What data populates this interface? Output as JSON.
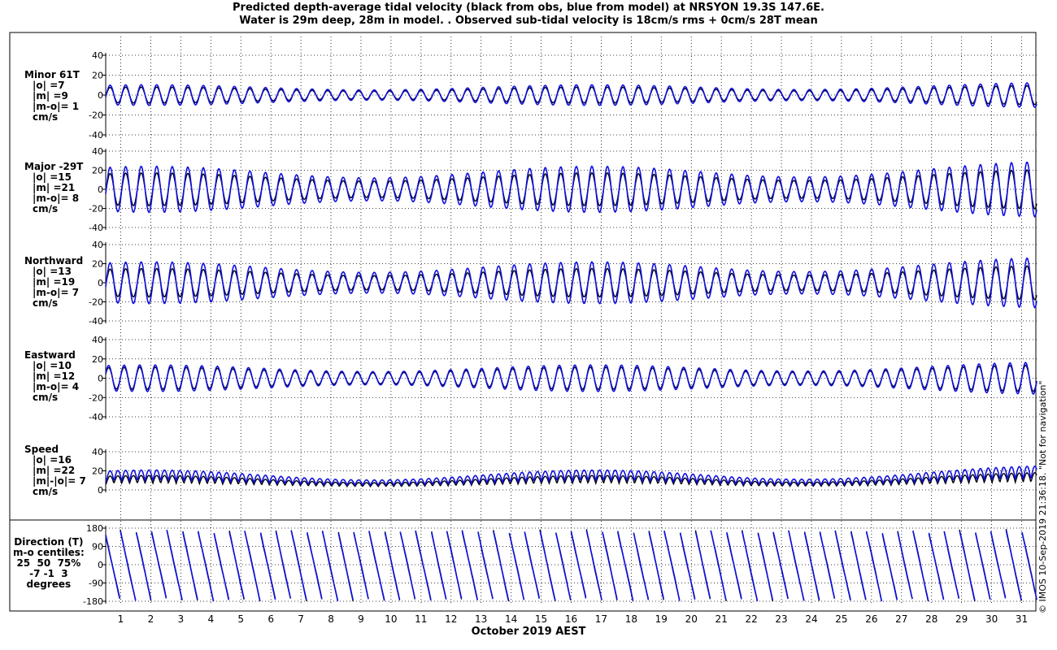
{
  "title": {
    "line1": "Predicted depth-average tidal velocity (black from obs, blue from model) at NRSYON 19.3S 147.6E.",
    "line2": "Water is 29m deep, 28m in model. . Observed sub-tidal velocity is 18cm/s rms + 0cm/s 28T mean"
  },
  "xlabel": "October 2019 AEST",
  "credit": "© IMOS 10-Sep-2019 21:36:18.  \"Not for navigation\"",
  "colors": {
    "obs": "#000000",
    "model": "#1010e0",
    "grid": "#000000"
  },
  "chart_data": {
    "type": "line",
    "x_ticks": [
      "1",
      "2",
      "3",
      "4",
      "5",
      "6",
      "7",
      "8",
      "9",
      "10",
      "11",
      "12",
      "13",
      "14",
      "15",
      "16",
      "17",
      "18",
      "19",
      "20",
      "21",
      "22",
      "23",
      "24",
      "25",
      "26",
      "27",
      "28",
      "29",
      "30",
      "31"
    ],
    "x_range_days": [
      0.5,
      31.5
    ],
    "panels": [
      {
        "key": "minor",
        "label_lines": [
          "Minor 61T",
          "|o| =7",
          "|m| =9",
          "|m-o|= 1",
          "cm/s"
        ],
        "yticks": [
          "40",
          "20",
          "0",
          "-20",
          "-40"
        ],
        "ylim": [
          -40,
          40
        ],
        "obs_amp": 7,
        "model_amp": 9
      },
      {
        "key": "major",
        "label_lines": [
          "Major -29T",
          "|o| =15",
          "|m| =21",
          "|m-o|= 8",
          "cm/s"
        ],
        "yticks": [
          "40",
          "20",
          "0",
          "-20",
          "-40"
        ],
        "ylim": [
          -40,
          40
        ],
        "obs_amp": 15,
        "model_amp": 21
      },
      {
        "key": "north",
        "label_lines": [
          "Northward",
          "|o| =13",
          "|m| =19",
          "|m-o|= 7",
          "cm/s"
        ],
        "yticks": [
          "40",
          "20",
          "0",
          "-20",
          "-40"
        ],
        "ylim": [
          -40,
          40
        ],
        "obs_amp": 13,
        "model_amp": 19
      },
      {
        "key": "east",
        "label_lines": [
          "Eastward",
          "|o| =10",
          "|m| =12",
          "|m-o|= 4",
          "cm/s"
        ],
        "yticks": [
          "40",
          "20",
          "0",
          "-20",
          "-40"
        ],
        "ylim": [
          -40,
          40
        ],
        "obs_amp": 10,
        "model_amp": 12
      },
      {
        "key": "speed",
        "label_lines": [
          "Speed",
          "|o| =16",
          "|m| =22",
          "|m|-|o|= 7",
          "cm/s"
        ],
        "yticks": [
          "40",
          "20",
          "0"
        ],
        "ylim": [
          0,
          40
        ],
        "obs_amp": 16,
        "model_amp": 22
      },
      {
        "key": "direction",
        "label_lines": [
          "Direction (T)",
          "m-o centiles:",
          "25  50  75%",
          "-7 -1  3",
          "degrees"
        ],
        "yticks": [
          "180",
          "90",
          "0",
          "-90",
          "-180"
        ],
        "ylim": [
          -180,
          180
        ]
      }
    ]
  }
}
